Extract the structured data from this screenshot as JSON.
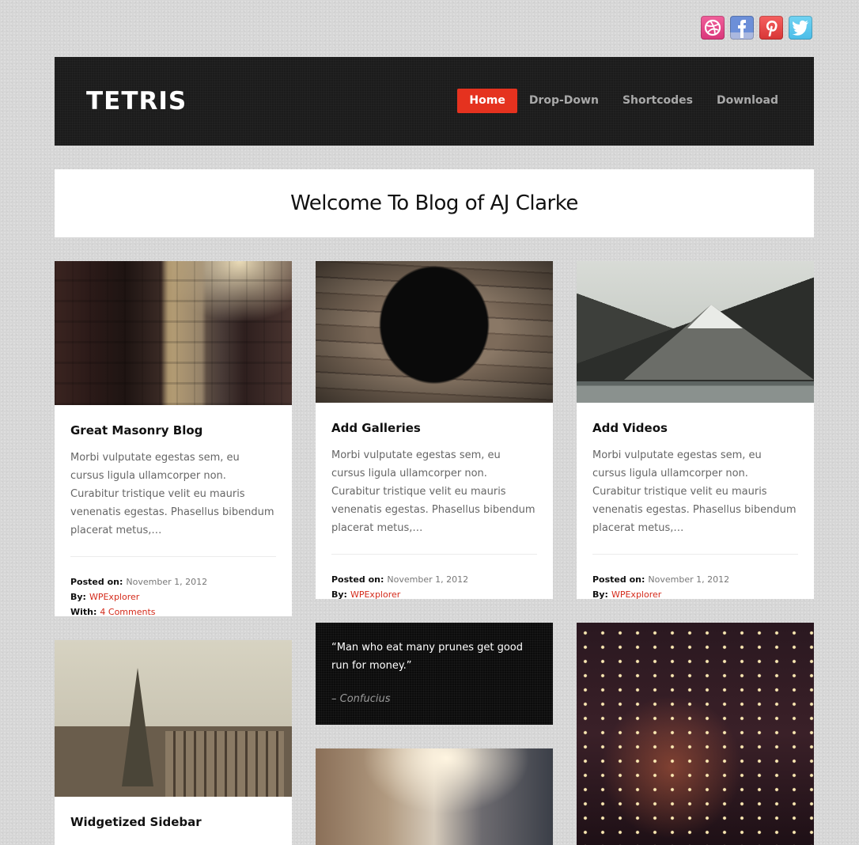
{
  "social": [
    {
      "name": "dribbble",
      "icon": "dribbble-icon",
      "color": "#e24a8a"
    },
    {
      "name": "facebook",
      "icon": "facebook-icon",
      "color": "#5b7fd0"
    },
    {
      "name": "pinterest",
      "icon": "pinterest-icon",
      "color": "#e64545"
    },
    {
      "name": "twitter",
      "icon": "twitter-icon",
      "color": "#5ac6ee"
    }
  ],
  "header": {
    "logo": "TETRIS",
    "nav": [
      {
        "label": "Home",
        "active": true
      },
      {
        "label": "Drop-Down",
        "active": false
      },
      {
        "label": "Shortcodes",
        "active": false
      },
      {
        "label": "Download",
        "active": false
      }
    ],
    "accent_color": "#e5321f"
  },
  "welcome": {
    "title": "Welcome To Blog of AJ Clarke"
  },
  "posts": [
    {
      "title": "Great Masonry Blog",
      "excerpt": "Morbi vulputate egestas sem, eu cursus ligula ullamcorper non. Curabitur tristique velit eu mauris venenatis egestas. Phasellus bibendum placerat metus,…",
      "posted_on_label": "Posted on:",
      "date": "November 1, 2012",
      "by_label": "By:",
      "author": "WPExplorer",
      "with_label": "With:",
      "comments": "4 Comments",
      "image": "city-buildings-photo"
    },
    {
      "title": "Add Galleries",
      "excerpt": "Morbi vulputate egestas sem, eu cursus ligula ullamcorper non. Curabitur tristique velit eu mauris venenatis egestas. Phasellus bibendum placerat metus,…",
      "posted_on_label": "Posted on:",
      "date": "November 1, 2012",
      "by_label": "By:",
      "author": "WPExplorer",
      "image": "black-dog-photo"
    },
    {
      "title": "Add Videos",
      "excerpt": "Morbi vulputate egestas sem, eu cursus ligula ullamcorper non. Curabitur tristique velit eu mauris venenatis egestas. Phasellus bibendum placerat metus,…",
      "posted_on_label": "Posted on:",
      "date": "November 1, 2012",
      "by_label": "By:",
      "author": "WPExplorer",
      "image": "mountain-photo"
    },
    {
      "title": "Widgetized Sidebar",
      "image": "eiffel-tower-photo"
    }
  ],
  "quote": {
    "text": "“Man who eat many prunes get good run for money.”",
    "author": "– Confucius"
  },
  "image_posts": [
    {
      "image": "street-bicycles-photo"
    },
    {
      "image": "string-lights-alley-photo"
    }
  ]
}
